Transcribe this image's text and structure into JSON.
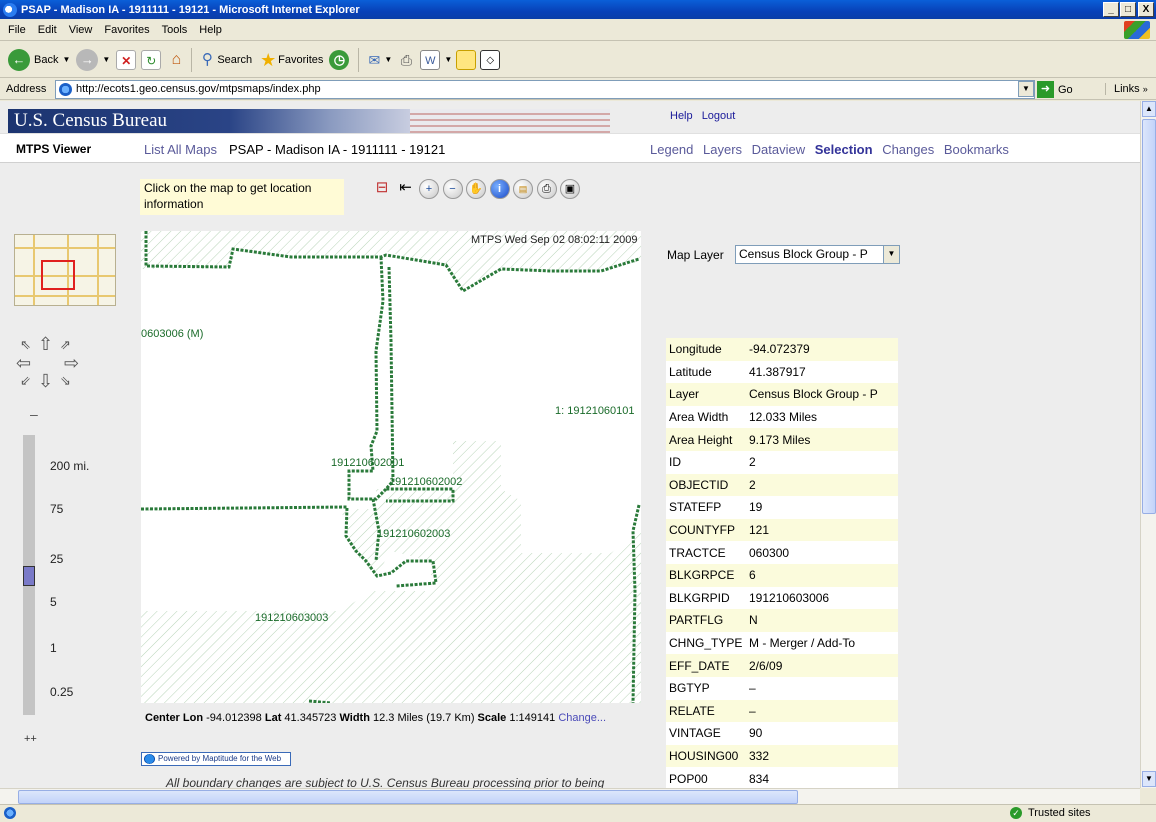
{
  "window": {
    "title": "PSAP - Madison IA - 1911111 - 19121 - Microsoft Internet Explorer",
    "controls": [
      "_",
      " ",
      "X"
    ]
  },
  "menu": [
    "File",
    "Edit",
    "View",
    "Favorites",
    "Tools",
    "Help"
  ],
  "toolbar": {
    "back": "Back",
    "search": "Search",
    "favorites": "Favorites"
  },
  "address": {
    "label": "Address",
    "url": "http://ecots1.geo.census.gov/mtpsmaps/index.php",
    "go": "Go",
    "links": "Links"
  },
  "header": {
    "banner": "U.S. Census Bureau",
    "help": "Help",
    "logout": "Logout",
    "app_title": "MTPS Viewer",
    "list_all_maps": "List All Maps",
    "map_title": "PSAP - Madison IA - 1911111 - 19121",
    "nav": [
      "Legend",
      "Layers",
      "Dataview",
      "Selection",
      "Changes",
      "Bookmarks"
    ],
    "active_nav": "Selection"
  },
  "instructions": "Click on the map to get location information",
  "map": {
    "timestamp": "MTPS Wed Sep 02 08:02:11 2009",
    "labels": [
      "0603006 (M)",
      "1: 19121060101",
      "191210602001",
      "191210602002",
      "191210602003",
      "191210603003"
    ]
  },
  "zoom": {
    "minus": "–",
    "plus": "++",
    "levels": [
      "200 mi.",
      "75",
      "25",
      "5",
      "1",
      "0.25"
    ],
    "level_value": "25"
  },
  "center": {
    "lon_label": "Center Lon",
    "lon": "-94.012398",
    "lat_label": "Lat",
    "lat": "41.345723",
    "width_label": "Width",
    "width": "12.3 Miles (19.7 Km)",
    "scale_label": "Scale",
    "scale": "1:149141",
    "change": "Change..."
  },
  "powered_by": "Powered by Maptitude for the Web",
  "disclaimer": "All boundary changes are subject to U.S. Census Bureau processing prior to being",
  "layer": {
    "label": "Map Layer",
    "selected": "Census Block Group - P"
  },
  "attributes": [
    {
      "k": "Longitude",
      "v": "-94.072379"
    },
    {
      "k": "Latitude",
      "v": "41.387917"
    },
    {
      "k": "Layer",
      "v": "Census Block Group - P"
    },
    {
      "k": "Area Width",
      "v": "12.033 Miles"
    },
    {
      "k": "Area Height",
      "v": "9.173 Miles"
    },
    {
      "k": "ID",
      "v": "2"
    },
    {
      "k": "OBJECTID",
      "v": "2"
    },
    {
      "k": "STATEFP",
      "v": "19"
    },
    {
      "k": "COUNTYFP",
      "v": "121"
    },
    {
      "k": "TRACTCE",
      "v": "060300"
    },
    {
      "k": "BLKGRPCE",
      "v": "6"
    },
    {
      "k": "BLKGRPID",
      "v": "191210603006"
    },
    {
      "k": "PARTFLG",
      "v": "N"
    },
    {
      "k": "CHNG_TYPE",
      "v": "M - Merger / Add-To"
    },
    {
      "k": "EFF_DATE",
      "v": "2/6/09"
    },
    {
      "k": "BGTYP",
      "v": "–"
    },
    {
      "k": "RELATE",
      "v": "–"
    },
    {
      "k": "VINTAGE",
      "v": "90"
    },
    {
      "k": "HOUSING00",
      "v": "332"
    },
    {
      "k": "POP00",
      "v": "834"
    }
  ],
  "status": {
    "zone": "Trusted sites"
  },
  "colors": {
    "boundary": "#2a7a3a",
    "hatch": "#bcd8bc",
    "banner": "#1c3470",
    "row_highlight": "#fbfbdc"
  }
}
